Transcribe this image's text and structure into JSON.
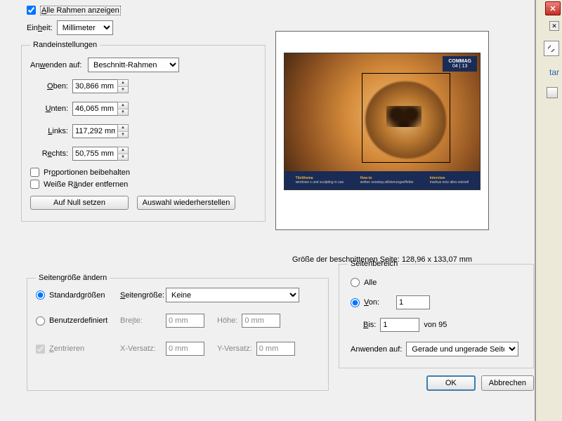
{
  "show_all_frames": {
    "label_pre": "A",
    "label_post": "lle Rahmen anzeigen",
    "checked": true
  },
  "unit": {
    "label_pre": "Ein",
    "label_u": "h",
    "label_post": "eit:",
    "value": "Millimeter"
  },
  "margins": {
    "legend": "Randeinstellungen",
    "apply_to": {
      "label_pre_a": "An",
      "label_u": "w",
      "label_post": "enden auf:",
      "value": "Beschnitt-Rahmen"
    },
    "top": {
      "label_u": "O",
      "label_post": "ben:",
      "value": "30,866 mm"
    },
    "bottom": {
      "label_u": "U",
      "label_post": "nten:",
      "value": "46,065 mm"
    },
    "left": {
      "label_u": "L",
      "label_post": "inks:",
      "value": "117,292 mm"
    },
    "right": {
      "label_pre": "R",
      "label_u": "e",
      "label_post": "chts:",
      "value": "50,755 mm"
    },
    "constrain": {
      "label_pre": "Pr",
      "label_u": "o",
      "label_post": "portionen beibehalten",
      "checked": false
    },
    "remove_white": {
      "label_pre": "Weiße R",
      "label_u": "ä",
      "label_post": "nder entfernen",
      "checked": false
    },
    "reset_btn": "Auf Null setzen",
    "restore_btn": "Auswahl wiederherstellen"
  },
  "preview": {
    "badge_line1": "COMMAG",
    "badge_line2": "04 | 13",
    "footer_col1_t": "Titelthema",
    "footer_col1_s": "windows x und sculpting in zao",
    "footer_col2_t": "How-to",
    "footer_col2_s": "welten soostop,stilisierungseffekte",
    "footer_col3_t": "Interview",
    "footer_col3_s": "markus netz alles wiznetl",
    "caption": "Größe der beschnittenen Seite: 128,96 x 133,07 mm"
  },
  "pagesize": {
    "legend": "Seitengröße ändern",
    "standard_label": "Standardgrößen",
    "custom_label": "Benutzerdefiniert",
    "pagesize_lbl_u": "S",
    "pagesize_lbl_post": "eitengröße:",
    "pagesize_value": "Keine",
    "width_lbl_pre": "Bre",
    "width_lbl_u": "i",
    "width_lbl_post": "te:",
    "width_value": "0 mm",
    "height_lbl": "Höhe:",
    "height_value": "0 mm",
    "center_lbl_u": "Z",
    "center_lbl_post": "entrieren",
    "xoff_lbl": "X-Versatz:",
    "xoff_value": "0 mm",
    "yoff_lbl": "Y-Versatz:",
    "yoff_value": "0 mm",
    "selected": "standard"
  },
  "range": {
    "legend": "Seitenbereich",
    "all_label": "Alle",
    "from_lbl_u": "V",
    "from_lbl_post": "on:",
    "from_value": "1",
    "to_lbl_u": "B",
    "to_lbl_post": "is:",
    "to_value": "1",
    "of_text": "von 95",
    "apply_label": "Anwenden auf:",
    "apply_value": "Gerade und ungerade Seiten",
    "selected": "from"
  },
  "buttons": {
    "ok": "OK",
    "cancel": "Abbrechen"
  },
  "rside": {
    "tar": "tar"
  }
}
